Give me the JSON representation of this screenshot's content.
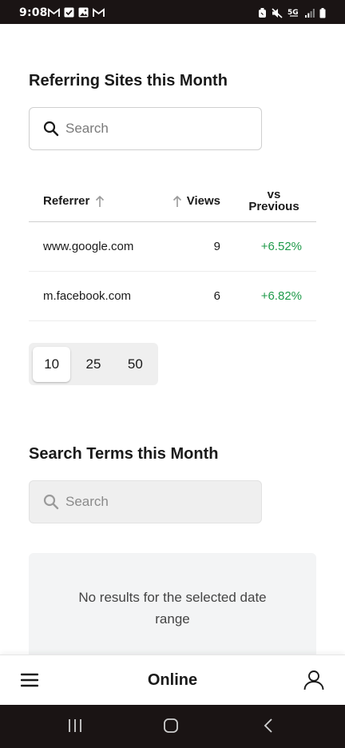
{
  "status_bar": {
    "time": "9:08",
    "left_icons": [
      "gmail-icon",
      "checkbox-icon",
      "image-icon",
      "gmail-icon"
    ],
    "right_icons": [
      "alarm-icon",
      "mute-icon",
      "5g-icon",
      "signal-icon",
      "battery-icon"
    ]
  },
  "referring_sites": {
    "title": "Referring Sites this Month",
    "search_placeholder": "Search",
    "columns": {
      "referrer": "Referrer",
      "views": "Views",
      "vs_line1": "vs",
      "vs_line2": "Previous"
    },
    "rows": [
      {
        "referrer": "www.google.com",
        "views": "9",
        "change": "+6.52%"
      },
      {
        "referrer": "m.facebook.com",
        "views": "6",
        "change": "+6.82%"
      }
    ],
    "page_sizes": [
      "10",
      "25",
      "50"
    ],
    "selected_page_size": "10"
  },
  "search_terms": {
    "title": "Search Terms this Month",
    "search_placeholder": "Search",
    "empty_message": "No results for the selected date range"
  },
  "app_nav": {
    "title": "Online",
    "menu_icon": "hamburger-menu-icon",
    "user_icon": "user-icon"
  },
  "colors": {
    "positive_change": "#1f9a4a",
    "status_bar_bg": "#1a1414"
  }
}
